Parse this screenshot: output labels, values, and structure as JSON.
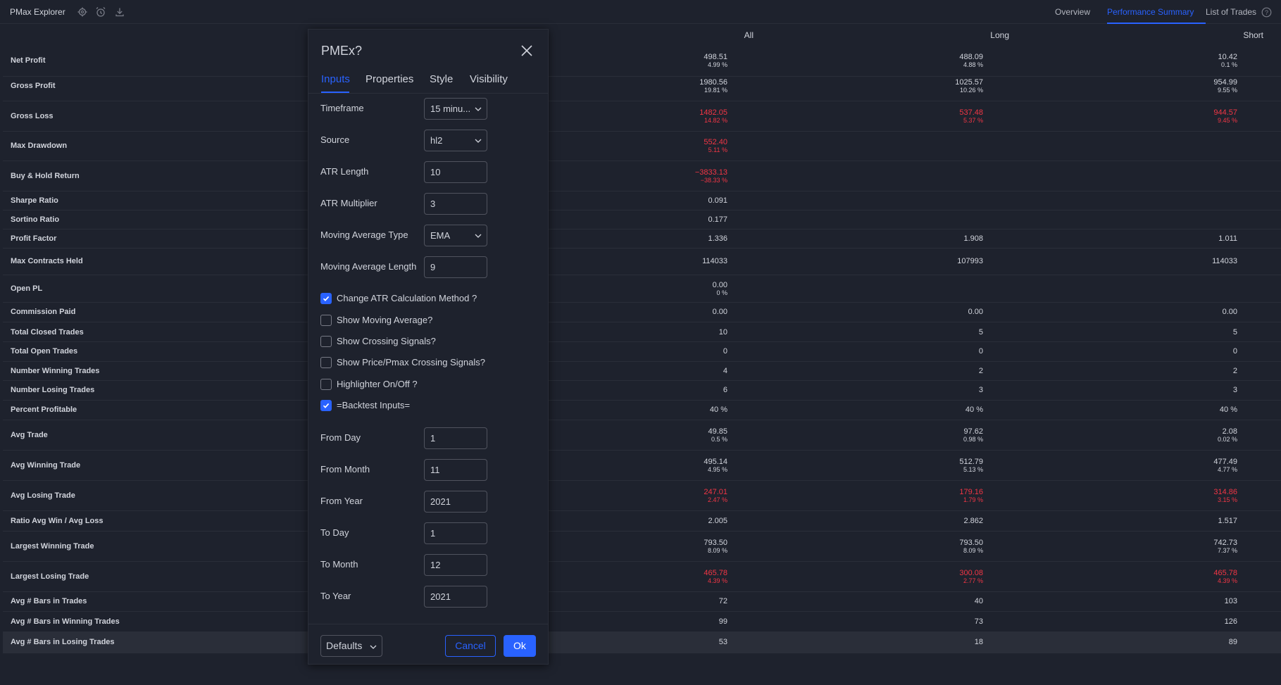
{
  "app": {
    "title": "PMax Explorer",
    "icons": [
      "gear-icon",
      "alarm-clock-icon",
      "download-icon"
    ],
    "tabs": [
      "Overview",
      "Performance Summary",
      "List of Trades"
    ],
    "active_tab": "Performance Summary",
    "help_icon": "help-icon"
  },
  "colors": {
    "accent": "#2962ff",
    "negative": "#f23645",
    "background": "#1e222d"
  },
  "table": {
    "columns": [
      "All",
      "Long",
      "Short"
    ],
    "rows": [
      {
        "label": "Net Profit",
        "all": {
          "v": "498.51",
          "p": "4.99 %"
        },
        "long": {
          "v": "488.09",
          "p": "4.88 %"
        },
        "short": {
          "v": "10.42",
          "p": "0.1 %"
        }
      },
      {
        "label": "Gross Profit",
        "all": {
          "v": "1980.56",
          "p": "19.81 %"
        },
        "long": {
          "v": "1025.57",
          "p": "10.26 %"
        },
        "short": {
          "v": "954.99",
          "p": "9.55 %"
        }
      },
      {
        "label": "Gross Loss",
        "neg": true,
        "all": {
          "v": "1482.05",
          "p": "14.82 %"
        },
        "long": {
          "v": "537.48",
          "p": "5.37 %"
        },
        "short": {
          "v": "944.57",
          "p": "9.45 %"
        }
      },
      {
        "label": "Max Drawdown",
        "neg": true,
        "all": {
          "v": "552.40",
          "p": "5.11 %"
        }
      },
      {
        "label": "Buy & Hold Return",
        "neg": true,
        "all": {
          "v": "−3833.13",
          "p": "−38.33 %"
        }
      },
      {
        "label": "Sharpe Ratio",
        "all": {
          "v": "0.091"
        }
      },
      {
        "label": "Sortino Ratio",
        "all": {
          "v": "0.177"
        }
      },
      {
        "label": "Profit Factor",
        "all": {
          "v": "1.336"
        },
        "long": {
          "v": "1.908"
        },
        "short": {
          "v": "1.011"
        }
      },
      {
        "label": "Max Contracts Held",
        "all": {
          "v": "114033"
        },
        "long": {
          "v": "107993"
        },
        "short": {
          "v": "114033"
        }
      },
      {
        "label": "Open PL",
        "all": {
          "v": "0.00",
          "p": "0 %"
        }
      },
      {
        "label": "Commission Paid",
        "all": {
          "v": "0.00"
        },
        "long": {
          "v": "0.00"
        },
        "short": {
          "v": "0.00"
        }
      },
      {
        "label": "Total Closed Trades",
        "all": {
          "v": "10"
        },
        "long": {
          "v": "5"
        },
        "short": {
          "v": "5"
        }
      },
      {
        "label": "Total Open Trades",
        "all": {
          "v": "0"
        },
        "long": {
          "v": "0"
        },
        "short": {
          "v": "0"
        }
      },
      {
        "label": "Number Winning Trades",
        "all": {
          "v": "4"
        },
        "long": {
          "v": "2"
        },
        "short": {
          "v": "2"
        }
      },
      {
        "label": "Number Losing Trades",
        "all": {
          "v": "6"
        },
        "long": {
          "v": "3"
        },
        "short": {
          "v": "3"
        }
      },
      {
        "label": "Percent Profitable",
        "all": {
          "v": "40 %"
        },
        "long": {
          "v": "40 %"
        },
        "short": {
          "v": "40 %"
        }
      },
      {
        "label": "Avg Trade",
        "all": {
          "v": "49.85",
          "p": "0.5 %"
        },
        "long": {
          "v": "97.62",
          "p": "0.98 %"
        },
        "short": {
          "v": "2.08",
          "p": "0.02 %"
        }
      },
      {
        "label": "Avg Winning Trade",
        "all": {
          "v": "495.14",
          "p": "4.95 %"
        },
        "long": {
          "v": "512.79",
          "p": "5.13 %"
        },
        "short": {
          "v": "477.49",
          "p": "4.77 %"
        }
      },
      {
        "label": "Avg Losing Trade",
        "neg": true,
        "all": {
          "v": "247.01",
          "p": "2.47 %"
        },
        "long": {
          "v": "179.16",
          "p": "1.79 %"
        },
        "short": {
          "v": "314.86",
          "p": "3.15 %"
        }
      },
      {
        "label": "Ratio Avg Win / Avg Loss",
        "all": {
          "v": "2.005"
        },
        "long": {
          "v": "2.862"
        },
        "short": {
          "v": "1.517"
        }
      },
      {
        "label": "Largest Winning Trade",
        "all": {
          "v": "793.50",
          "p": "8.09 %"
        },
        "long": {
          "v": "793.50",
          "p": "8.09 %"
        },
        "short": {
          "v": "742.73",
          "p": "7.37 %"
        }
      },
      {
        "label": "Largest Losing Trade",
        "neg": true,
        "all": {
          "v": "465.78",
          "p": "4.39 %"
        },
        "long": {
          "v": "300.08",
          "p": "2.77 %"
        },
        "short": {
          "v": "465.78",
          "p": "4.39 %"
        }
      },
      {
        "label": "Avg # Bars in Trades",
        "all": {
          "v": "72"
        },
        "long": {
          "v": "40"
        },
        "short": {
          "v": "103"
        }
      },
      {
        "label": "Avg # Bars in Winning Trades",
        "all": {
          "v": "99"
        },
        "long": {
          "v": "73"
        },
        "short": {
          "v": "126"
        }
      },
      {
        "label": "Avg # Bars in Losing Trades",
        "highlight": true,
        "all": {
          "v": "53"
        },
        "long": {
          "v": "18"
        },
        "short": {
          "v": "89"
        }
      }
    ]
  },
  "dialog": {
    "title": "PMEx?",
    "close_icon": "close-icon",
    "tabs": [
      "Inputs",
      "Properties",
      "Style",
      "Visibility"
    ],
    "active_tab": "Inputs",
    "fields": [
      {
        "type": "select",
        "label": "Timeframe",
        "value": "15 minu..."
      },
      {
        "type": "select",
        "label": "Source",
        "value": "hl2"
      },
      {
        "type": "input",
        "label": "ATR Length",
        "value": "10"
      },
      {
        "type": "input",
        "label": "ATR Multiplier",
        "value": "3"
      },
      {
        "type": "select",
        "label": "Moving Average Type",
        "value": "EMA"
      },
      {
        "type": "input",
        "label": "Moving Average Length",
        "value": "9"
      },
      {
        "type": "checkbox",
        "label": "Change ATR Calculation Method ?",
        "checked": true
      },
      {
        "type": "checkbox",
        "label": "Show Moving Average?",
        "checked": false
      },
      {
        "type": "checkbox",
        "label": "Show Crossing Signals?",
        "checked": false
      },
      {
        "type": "checkbox",
        "label": "Show Price/Pmax Crossing Signals?",
        "checked": false
      },
      {
        "type": "checkbox",
        "label": "Highlighter On/Off ?",
        "checked": false
      },
      {
        "type": "checkbox",
        "label": "=Backtest Inputs=",
        "checked": true
      },
      {
        "type": "input",
        "label": "From Day",
        "value": "1"
      },
      {
        "type": "input",
        "label": "From Month",
        "value": "11"
      },
      {
        "type": "input",
        "label": "From Year",
        "value": "2021"
      },
      {
        "type": "input",
        "label": "To Day",
        "value": "1"
      },
      {
        "type": "input",
        "label": "To Month",
        "value": "12"
      },
      {
        "type": "input",
        "label": "To Year",
        "value": "2021"
      }
    ],
    "footer": {
      "defaults_label": "Defaults",
      "cancel_label": "Cancel",
      "ok_label": "Ok"
    }
  }
}
